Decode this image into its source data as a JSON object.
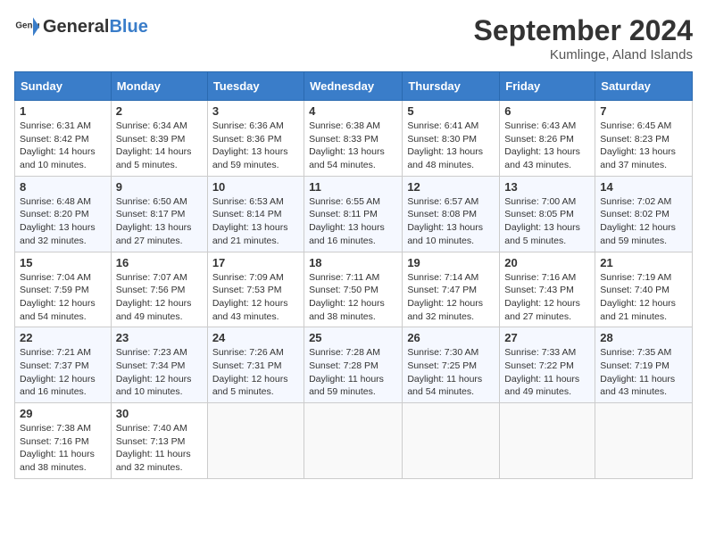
{
  "header": {
    "logo_general": "General",
    "logo_blue": "Blue",
    "month_title": "September 2024",
    "location": "Kumlinge, Aland Islands"
  },
  "days_of_week": [
    "Sunday",
    "Monday",
    "Tuesday",
    "Wednesday",
    "Thursday",
    "Friday",
    "Saturday"
  ],
  "weeks": [
    [
      {
        "day": "1",
        "info": "Sunrise: 6:31 AM\nSunset: 8:42 PM\nDaylight: 14 hours\nand 10 minutes."
      },
      {
        "day": "2",
        "info": "Sunrise: 6:34 AM\nSunset: 8:39 PM\nDaylight: 14 hours\nand 5 minutes."
      },
      {
        "day": "3",
        "info": "Sunrise: 6:36 AM\nSunset: 8:36 PM\nDaylight: 13 hours\nand 59 minutes."
      },
      {
        "day": "4",
        "info": "Sunrise: 6:38 AM\nSunset: 8:33 PM\nDaylight: 13 hours\nand 54 minutes."
      },
      {
        "day": "5",
        "info": "Sunrise: 6:41 AM\nSunset: 8:30 PM\nDaylight: 13 hours\nand 48 minutes."
      },
      {
        "day": "6",
        "info": "Sunrise: 6:43 AM\nSunset: 8:26 PM\nDaylight: 13 hours\nand 43 minutes."
      },
      {
        "day": "7",
        "info": "Sunrise: 6:45 AM\nSunset: 8:23 PM\nDaylight: 13 hours\nand 37 minutes."
      }
    ],
    [
      {
        "day": "8",
        "info": "Sunrise: 6:48 AM\nSunset: 8:20 PM\nDaylight: 13 hours\nand 32 minutes."
      },
      {
        "day": "9",
        "info": "Sunrise: 6:50 AM\nSunset: 8:17 PM\nDaylight: 13 hours\nand 27 minutes."
      },
      {
        "day": "10",
        "info": "Sunrise: 6:53 AM\nSunset: 8:14 PM\nDaylight: 13 hours\nand 21 minutes."
      },
      {
        "day": "11",
        "info": "Sunrise: 6:55 AM\nSunset: 8:11 PM\nDaylight: 13 hours\nand 16 minutes."
      },
      {
        "day": "12",
        "info": "Sunrise: 6:57 AM\nSunset: 8:08 PM\nDaylight: 13 hours\nand 10 minutes."
      },
      {
        "day": "13",
        "info": "Sunrise: 7:00 AM\nSunset: 8:05 PM\nDaylight: 13 hours\nand 5 minutes."
      },
      {
        "day": "14",
        "info": "Sunrise: 7:02 AM\nSunset: 8:02 PM\nDaylight: 12 hours\nand 59 minutes."
      }
    ],
    [
      {
        "day": "15",
        "info": "Sunrise: 7:04 AM\nSunset: 7:59 PM\nDaylight: 12 hours\nand 54 minutes."
      },
      {
        "day": "16",
        "info": "Sunrise: 7:07 AM\nSunset: 7:56 PM\nDaylight: 12 hours\nand 49 minutes."
      },
      {
        "day": "17",
        "info": "Sunrise: 7:09 AM\nSunset: 7:53 PM\nDaylight: 12 hours\nand 43 minutes."
      },
      {
        "day": "18",
        "info": "Sunrise: 7:11 AM\nSunset: 7:50 PM\nDaylight: 12 hours\nand 38 minutes."
      },
      {
        "day": "19",
        "info": "Sunrise: 7:14 AM\nSunset: 7:47 PM\nDaylight: 12 hours\nand 32 minutes."
      },
      {
        "day": "20",
        "info": "Sunrise: 7:16 AM\nSunset: 7:43 PM\nDaylight: 12 hours\nand 27 minutes."
      },
      {
        "day": "21",
        "info": "Sunrise: 7:19 AM\nSunset: 7:40 PM\nDaylight: 12 hours\nand 21 minutes."
      }
    ],
    [
      {
        "day": "22",
        "info": "Sunrise: 7:21 AM\nSunset: 7:37 PM\nDaylight: 12 hours\nand 16 minutes."
      },
      {
        "day": "23",
        "info": "Sunrise: 7:23 AM\nSunset: 7:34 PM\nDaylight: 12 hours\nand 10 minutes."
      },
      {
        "day": "24",
        "info": "Sunrise: 7:26 AM\nSunset: 7:31 PM\nDaylight: 12 hours\nand 5 minutes."
      },
      {
        "day": "25",
        "info": "Sunrise: 7:28 AM\nSunset: 7:28 PM\nDaylight: 11 hours\nand 59 minutes."
      },
      {
        "day": "26",
        "info": "Sunrise: 7:30 AM\nSunset: 7:25 PM\nDaylight: 11 hours\nand 54 minutes."
      },
      {
        "day": "27",
        "info": "Sunrise: 7:33 AM\nSunset: 7:22 PM\nDaylight: 11 hours\nand 49 minutes."
      },
      {
        "day": "28",
        "info": "Sunrise: 7:35 AM\nSunset: 7:19 PM\nDaylight: 11 hours\nand 43 minutes."
      }
    ],
    [
      {
        "day": "29",
        "info": "Sunrise: 7:38 AM\nSunset: 7:16 PM\nDaylight: 11 hours\nand 38 minutes."
      },
      {
        "day": "30",
        "info": "Sunrise: 7:40 AM\nSunset: 7:13 PM\nDaylight: 11 hours\nand 32 minutes."
      },
      {
        "day": "",
        "info": ""
      },
      {
        "day": "",
        "info": ""
      },
      {
        "day": "",
        "info": ""
      },
      {
        "day": "",
        "info": ""
      },
      {
        "day": "",
        "info": ""
      }
    ]
  ]
}
